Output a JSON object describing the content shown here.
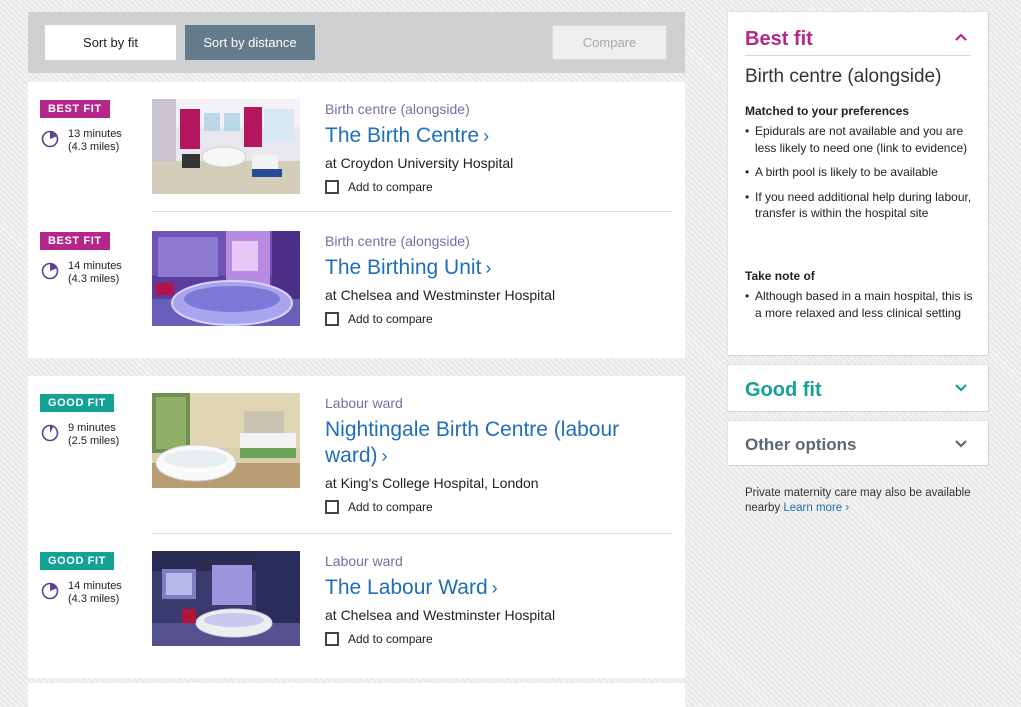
{
  "toolbar": {
    "sort_fit_label": "Sort by fit",
    "sort_distance_label": "Sort by distance",
    "compare_label": "Compare"
  },
  "results": [
    {
      "badge": "BEST FIT",
      "badge_kind": "best",
      "time": "13 minutes",
      "miles": "(4.3 miles)",
      "type": "Birth centre (alongside)",
      "title": "The Birth Centre",
      "hospital": "at Croydon University Hospital",
      "compare": "Add to compare"
    },
    {
      "badge": "BEST FIT",
      "badge_kind": "best",
      "time": "14 minutes",
      "miles": "(4.3 miles)",
      "type": "Birth centre (alongside)",
      "title": "The Birthing Unit",
      "hospital": "at Chelsea and Westminster Hospital",
      "compare": "Add to compare"
    },
    {
      "badge": "GOOD FIT",
      "badge_kind": "good",
      "time": "9 minutes",
      "miles": "(2.5 miles)",
      "type": "Labour ward",
      "title_line1": "Nightingale Birth Centre (labour",
      "title_line2": "ward)",
      "hospital": "at King's College Hospital, London",
      "compare": "Add to compare"
    },
    {
      "badge": "GOOD FIT",
      "badge_kind": "good",
      "time": "14 minutes",
      "miles": "(4.3 miles)",
      "type": "Labour ward",
      "title": "The Labour Ward",
      "hospital": "at Chelsea and Westminster Hospital",
      "compare": "Add to compare"
    }
  ],
  "sidebar": {
    "best": {
      "header": "Best fit",
      "subtitle": "Birth centre (alongside)",
      "matched_heading": "Matched to your preferences",
      "matched": [
        "Epidurals are not available and you are less likely to need one (link to evidence)",
        "A birth pool is likely to be available",
        "If you need additional help during labour, transfer is within the hospital site"
      ],
      "note_heading": "Take note of",
      "notes": [
        "Although based in a main hospital, this is a more relaxed and less clinical setting"
      ]
    },
    "good": {
      "header": "Good fit"
    },
    "other": {
      "header": "Other options"
    },
    "private_note": "Private maternity care may also be available nearby",
    "learn_more": "Learn more"
  },
  "colors": {
    "best_fit": "#b6278d",
    "good_fit": "#14a296",
    "link": "#1e6fb8",
    "type_label": "#7d6aa6",
    "active_sort": "#637b8a"
  }
}
